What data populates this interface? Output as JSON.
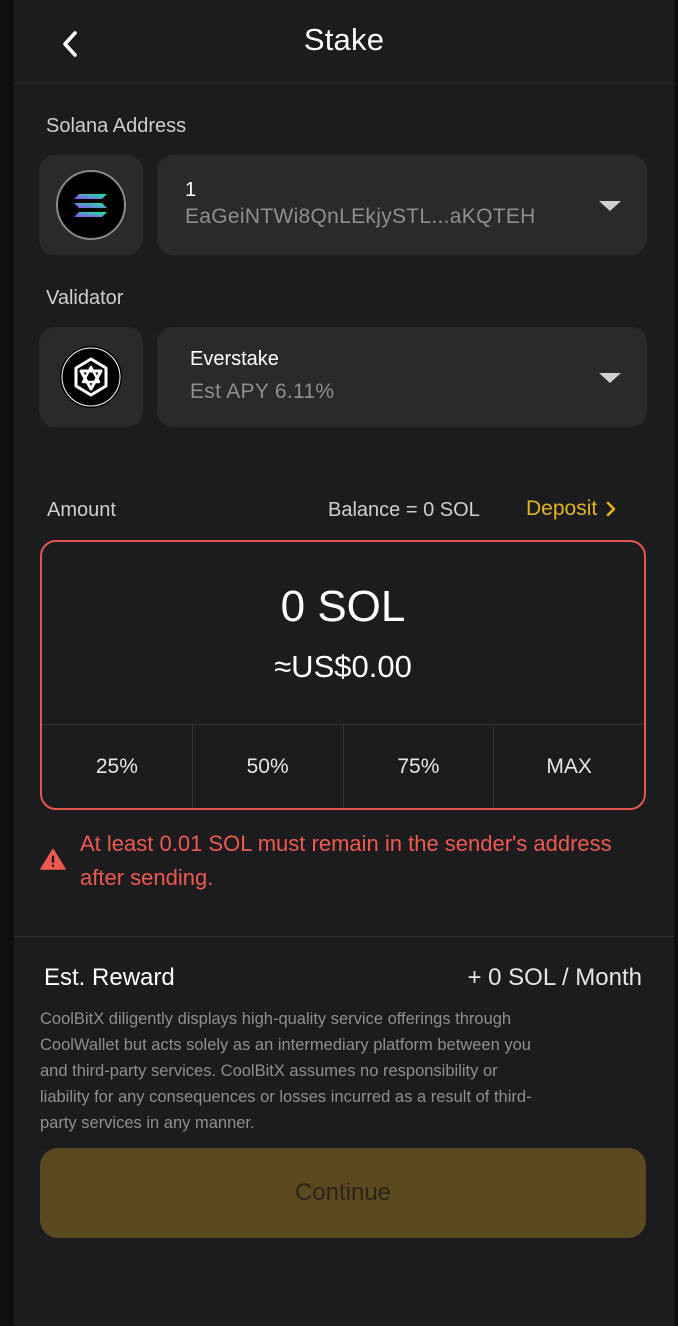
{
  "header": {
    "title": "Stake"
  },
  "address": {
    "label": "Solana Address",
    "account_name": "1",
    "account_address": "EaGeiNTWi8QnLEkjySTL...aKQTEH"
  },
  "validator": {
    "label": "Validator",
    "name": "Everstake",
    "apy": "Est APY 6.11%"
  },
  "amount": {
    "label": "Amount",
    "balance": "Balance = 0 SOL",
    "deposit_label": "Deposit",
    "sol_value": "0 SOL",
    "usd_value": "≈US$0.00",
    "pct_buttons": [
      "25%",
      "50%",
      "75%",
      "MAX"
    ]
  },
  "warning": {
    "line1": "At least 0.01 SOL must remain in the sender's address",
    "line2": "after sending."
  },
  "reward": {
    "label": "Est. Reward",
    "value": "+ 0 SOL / Month"
  },
  "disclaimer": {
    "line1": "CoolBitX diligently displays high-quality service offerings through",
    "line2": "CoolWallet but acts solely as an intermediary platform between you",
    "line3": "and third-party services. CoolBitX assumes no responsibility or",
    "line4": "liability for any consequences or losses incurred as a result of third-",
    "line5": "party services in any manner."
  },
  "footer": {
    "continue_label": "Continue"
  },
  "colors": {
    "background": "#1c1c1e",
    "card": "#2a2a2c",
    "accent": "#e3b31c",
    "error": "#e0584f",
    "continue_disabled": "#5b4a1f"
  }
}
